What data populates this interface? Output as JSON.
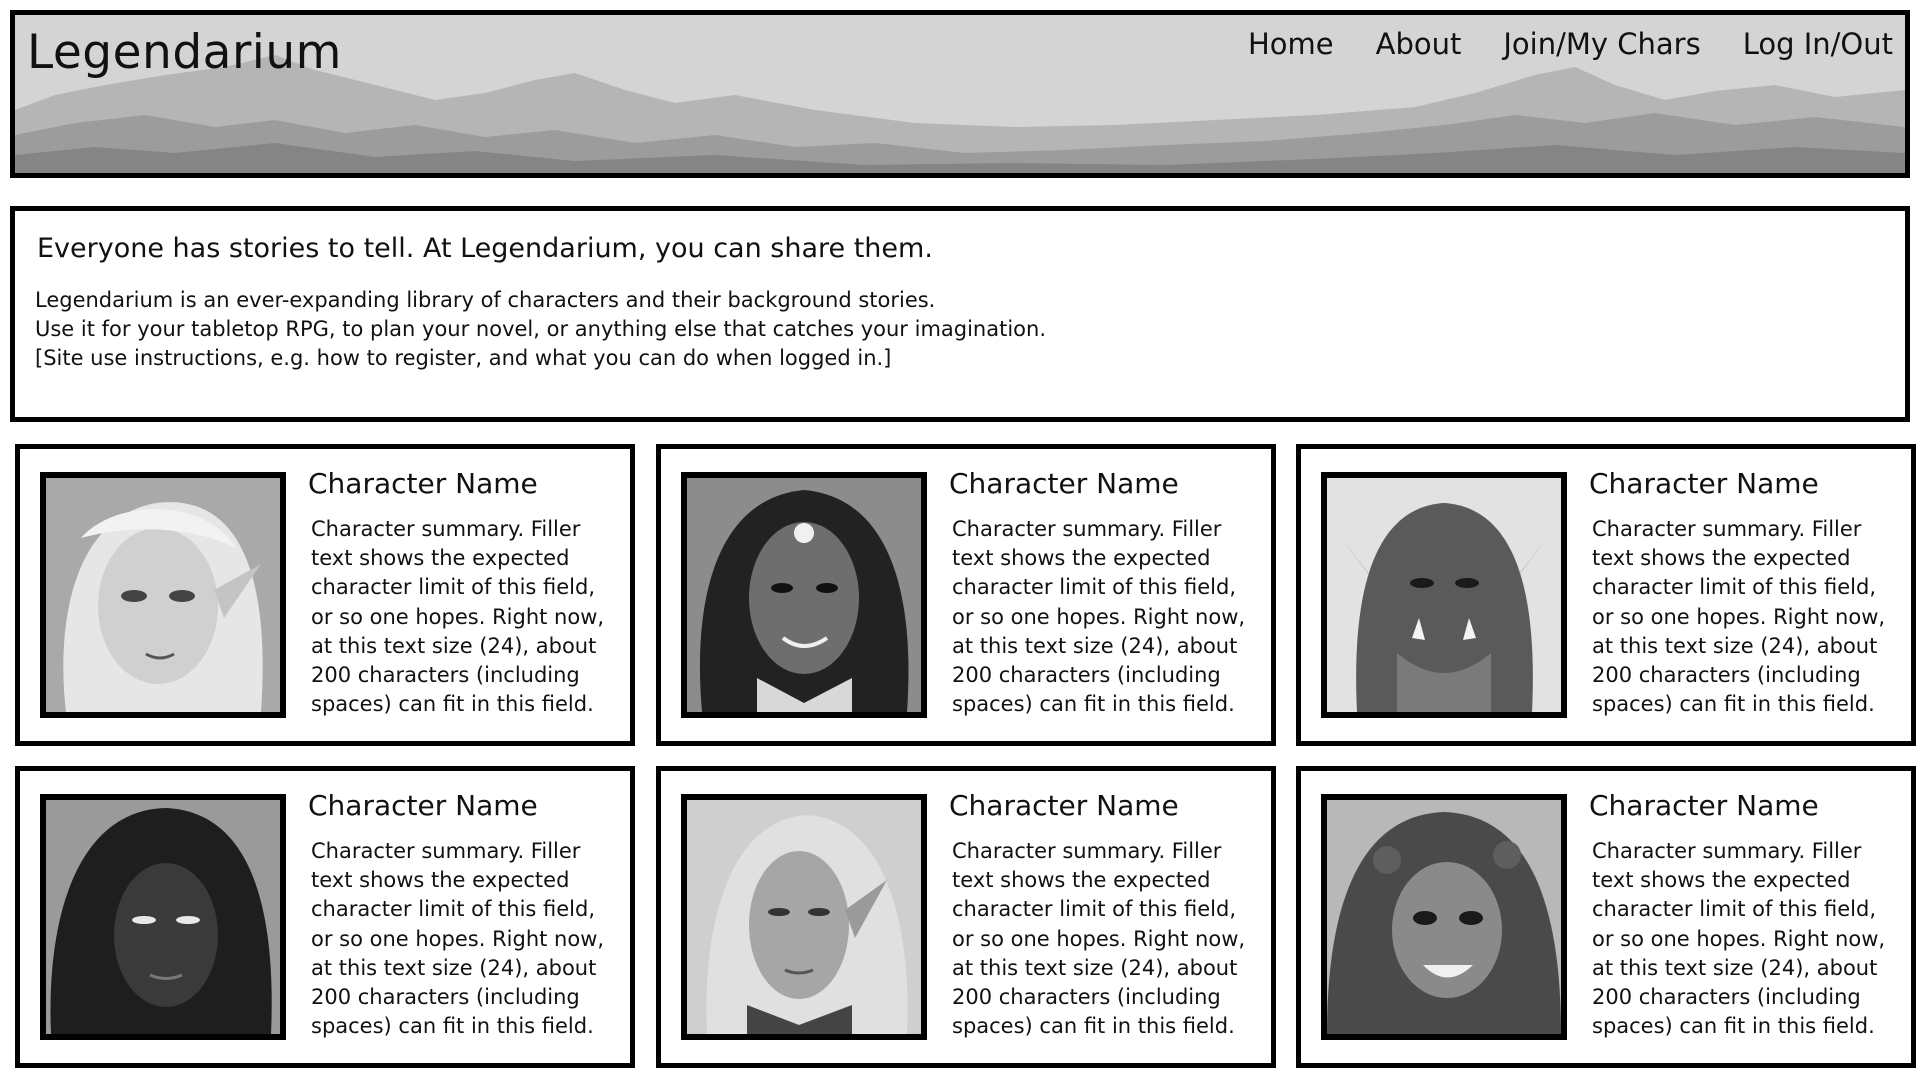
{
  "header": {
    "title": "Legendarium",
    "nav": [
      "Home",
      "About",
      "Join/My Chars",
      "Log In/Out"
    ]
  },
  "intro": {
    "heading": "Everyone has stories to tell.  At Legendarium, you can share them.",
    "lines": [
      "Legendarium is an ever-expanding library of characters and their background stories.",
      "Use it for your tabletop RPG, to plan your novel, or anything else that catches your imagination.",
      "[Site use instructions, e.g. how to register, and what you can do when logged in.]"
    ]
  },
  "cards": [
    {
      "name": "Character Name",
      "summary": "Character summary. Filler text shows the expected character limit of this field, or so one hopes.  Right now, at this text size (24), about 200 characters (including spaces) can fit in this field.",
      "portrait": "blonde-elf-woman-portrait"
    },
    {
      "name": "Character Name",
      "summary": "Character summary. Filler text shows the expected character limit of this field, or so one hopes.  Right now, at this text size (24), about 200 characters (including spaces) can fit in this field.",
      "portrait": "tattooed-woman-portrait"
    },
    {
      "name": "Character Name",
      "summary": "Character summary. Filler text shows the expected character limit of this field, or so one hopes.  Right now, at this text size (24), about 200 characters (including spaces) can fit in this field.",
      "portrait": "orc-warrior-portrait"
    },
    {
      "name": "Character Name",
      "summary": "Character summary. Filler text shows the expected character limit of this field, or so one hopes.  Right now, at this text size (24), about 200 characters (including spaces) can fit in this field.",
      "portrait": "hooded-figure-portrait"
    },
    {
      "name": "Character Name",
      "summary": "Character summary. Filler text shows the expected character limit of this field, or so one hopes.  Right now, at this text size (24), about 200 characters (including spaces) can fit in this field.",
      "portrait": "elf-man-portrait"
    },
    {
      "name": "Character Name",
      "summary": "Character summary. Filler text shows the expected character limit of this field, or so one hopes.  Right now, at this text size (24), about 200 characters (including spaces) can fit in this field.",
      "portrait": "curly-haired-woman-portrait"
    }
  ]
}
